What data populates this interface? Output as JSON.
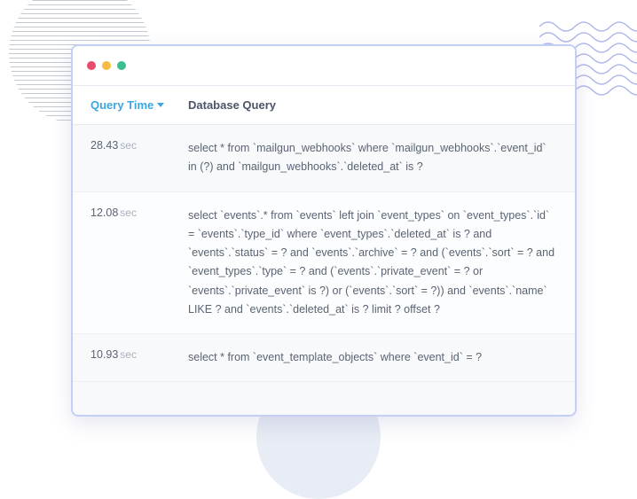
{
  "headers": {
    "time": "Query Time",
    "query": "Database Query"
  },
  "time_unit": "sec",
  "rows": [
    {
      "time": "28.43",
      "query": "select * from `mailgun_webhooks` where `mailgun_webhooks`.`event_id` in (?) and `mailgun_webhooks`.`deleted_at` is ?"
    },
    {
      "time": "12.08",
      "query": "select `events`.* from `events` left join `event_types` on `event_types`.`id` = `events`.`type_id` where `event_types`.`deleted_at` is ? and `events`.`status` = ? and `events`.`archive` = ? and (`events`.`sort` = ? and `event_types`.`type` = ? and (`events`.`private_event` = ? or `events`.`private_event` is ?) or (`events`.`sort` = ?)) and `events`.`name` LIKE ? and `events`.`deleted_at` is ? limit ? offset ?"
    },
    {
      "time": "10.93",
      "query": "select * from `event_template_objects` where `event_id` = ?"
    }
  ]
}
